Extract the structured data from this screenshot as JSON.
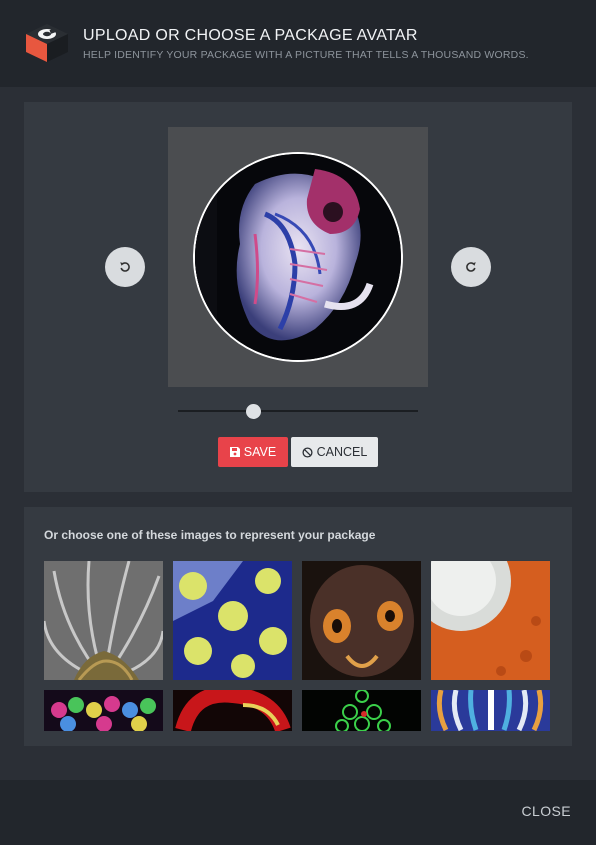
{
  "header": {
    "title": "UPLOAD OR CHOOSE A PACKAGE AVATAR",
    "subtitle": "HELP IDENTIFY YOUR PACKAGE WITH A PICTURE THAT TELLS A THOUSAND WORDS.",
    "logo_icon": "package-box-icon"
  },
  "editor": {
    "rotate_left_icon": "rotate-left-icon",
    "rotate_right_icon": "rotate-right-icon",
    "zoom_value": 0.3,
    "save_label": "SAVE",
    "save_icon": "floppy-disk-icon",
    "cancel_label": "CANCEL",
    "cancel_icon": "ban-icon"
  },
  "gallery": {
    "label": "Or choose one of these images to represent your package",
    "images": [
      "feathery-spines",
      "yellow-spores-on-blue",
      "orange-eyed-larva",
      "white-tuft-on-orange",
      "colorful-cell-cluster",
      "red-coil",
      "green-cells-on-black",
      "blue-striped-pattern"
    ]
  },
  "footer": {
    "close_label": "CLOSE"
  },
  "colors": {
    "accent": "#e8434a",
    "header_bg": "#22262c",
    "panel_bg": "#353a41"
  }
}
